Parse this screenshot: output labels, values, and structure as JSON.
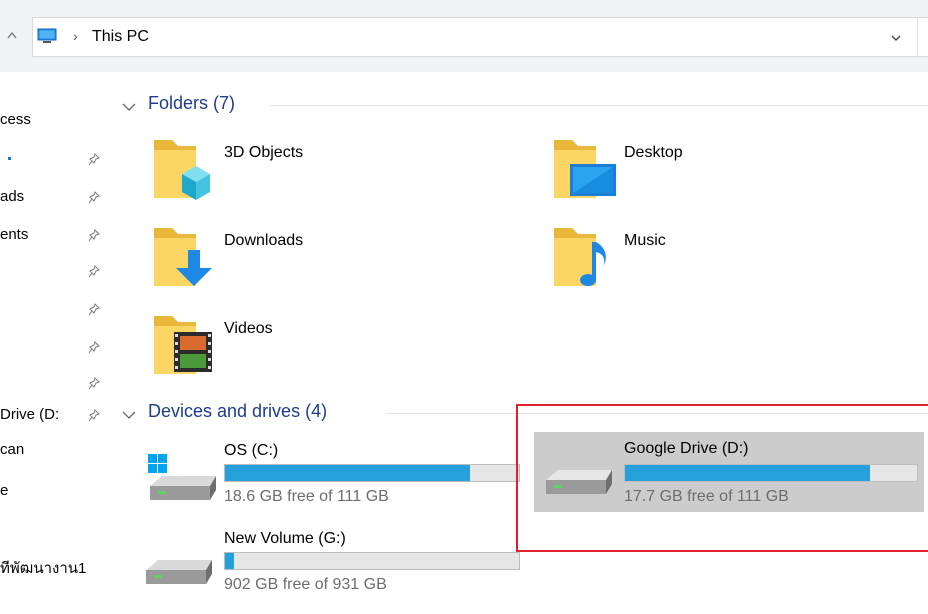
{
  "address_bar": {
    "separator": "›",
    "location": "This PC"
  },
  "nav_pane": {
    "items": [
      {
        "label": "cess",
        "pinned": false,
        "color": "#000000"
      },
      {
        "label": "",
        "pinned": true,
        "color": "#1e73c8"
      },
      {
        "label": "ads",
        "pinned": true,
        "color": "#000000"
      },
      {
        "label": "ents",
        "pinned": true,
        "color": "#000000"
      },
      {
        "label": "",
        "pinned": true,
        "color": "#000000"
      },
      {
        "label": "",
        "pinned": true,
        "color": "#000000"
      },
      {
        "label": "",
        "pinned": true,
        "color": "#000000"
      },
      {
        "label": "",
        "pinned": true,
        "color": "#000000"
      },
      {
        "label": "Drive (D:",
        "pinned": true,
        "color": "#000000"
      },
      {
        "label": "can",
        "pinned": false,
        "color": "#000000"
      },
      {
        "label": "e",
        "pinned": false,
        "color": "#000000"
      },
      {
        "label": "ทีพัฒนางาน1",
        "pinned": false,
        "color": "#000000"
      }
    ]
  },
  "groups": {
    "folders": {
      "label": "Folders (7)",
      "items": [
        {
          "name": "3D Objects",
          "icon": "3d-objects-folder-icon"
        },
        {
          "name": "Desktop",
          "icon": "desktop-folder-icon"
        },
        {
          "name": "Downloads",
          "icon": "downloads-folder-icon"
        },
        {
          "name": "Music",
          "icon": "music-folder-icon"
        },
        {
          "name": "Videos",
          "icon": "videos-folder-icon"
        }
      ]
    },
    "drives": {
      "label": "Devices and drives (4)",
      "items": [
        {
          "name": "OS (C:)",
          "free_text": "18.6 GB free of 111 GB",
          "used_fraction": 0.832,
          "windows_logo": true,
          "selected": false
        },
        {
          "name": "Google Drive (D:)",
          "free_text": "17.7 GB free of 111 GB",
          "used_fraction": 0.84,
          "windows_logo": false,
          "selected": true
        },
        {
          "name": "New Volume (G:)",
          "free_text": "902 GB free of 931 GB",
          "used_fraction": 0.031,
          "windows_logo": false,
          "selected": false
        }
      ]
    }
  },
  "colors": {
    "accent_bar": "#26a0da",
    "group_header": "#1e3c8c",
    "selection": "#cccccc",
    "highlight_box": "#e0202a"
  }
}
